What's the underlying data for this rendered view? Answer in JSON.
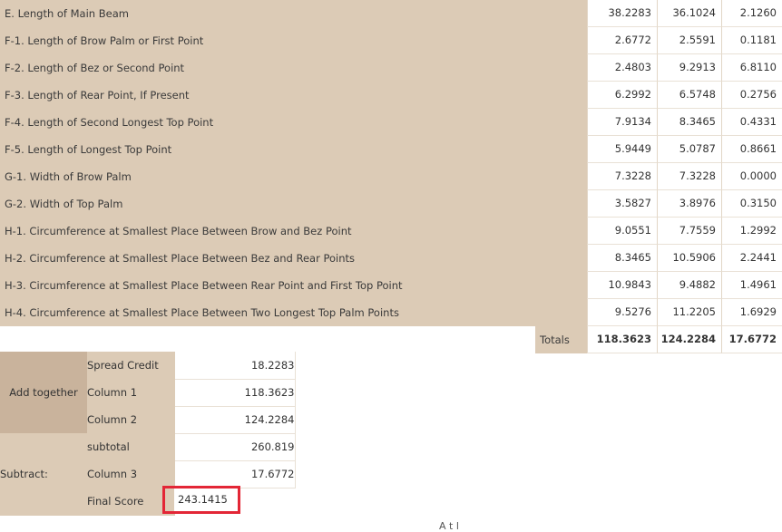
{
  "measurements": [
    {
      "label": "E. Length of Main Beam",
      "c1": "38.2283",
      "c2": "36.1024",
      "c3": "2.1260"
    },
    {
      "label": "F-1. Length of Brow Palm or First Point",
      "c1": "2.6772",
      "c2": "2.5591",
      "c3": "0.1181"
    },
    {
      "label": "F-2. Length of Bez or Second Point",
      "c1": "2.4803",
      "c2": "9.2913",
      "c3": "6.8110"
    },
    {
      "label": "F-3. Length of Rear Point, If Present",
      "c1": "6.2992",
      "c2": "6.5748",
      "c3": "0.2756"
    },
    {
      "label": "F-4. Length of Second Longest Top Point",
      "c1": "7.9134",
      "c2": "8.3465",
      "c3": "0.4331"
    },
    {
      "label": "F-5. Length of Longest Top Point",
      "c1": "5.9449",
      "c2": "5.0787",
      "c3": "0.8661"
    },
    {
      "label": "G-1. Width of Brow Palm",
      "c1": "7.3228",
      "c2": "7.3228",
      "c3": "0.0000"
    },
    {
      "label": "G-2. Width of Top Palm",
      "c1": "3.5827",
      "c2": "3.8976",
      "c3": "0.3150"
    },
    {
      "label": "H-1. Circumference at Smallest Place Between Brow and Bez Point",
      "c1": "9.0551",
      "c2": "7.7559",
      "c3": "1.2992"
    },
    {
      "label": "H-2. Circumference at Smallest Place Between Bez and Rear Points",
      "c1": "8.3465",
      "c2": "10.5906",
      "c3": "2.2441"
    },
    {
      "label": "H-3. Circumference at Smallest Place Between Rear Point and First Top Point",
      "c1": "10.9843",
      "c2": "9.4882",
      "c3": "1.4961"
    },
    {
      "label": "H-4. Circumference at Smallest Place Between Two Longest Top Palm Points",
      "c1": "9.5276",
      "c2": "11.2205",
      "c3": "1.6929"
    }
  ],
  "totals": {
    "label": "Totals",
    "c1": "118.3623",
    "c2": "124.2284",
    "c3": "17.6772"
  },
  "calc": {
    "add_label": "Add together",
    "subtract_label": "Subtract:",
    "spread_credit_label": "Spread Credit",
    "spread_credit": "18.2283",
    "column1_label": "Column 1",
    "column1": "118.3623",
    "column2_label": "Column 2",
    "column2": "124.2284",
    "subtotal_label": "subtotal",
    "subtotal": "260.819",
    "column3_label": "Column 3",
    "column3": "17.6772",
    "final_label": "Final Score",
    "final": "243.1415"
  },
  "footer_cut_text": "A t l"
}
